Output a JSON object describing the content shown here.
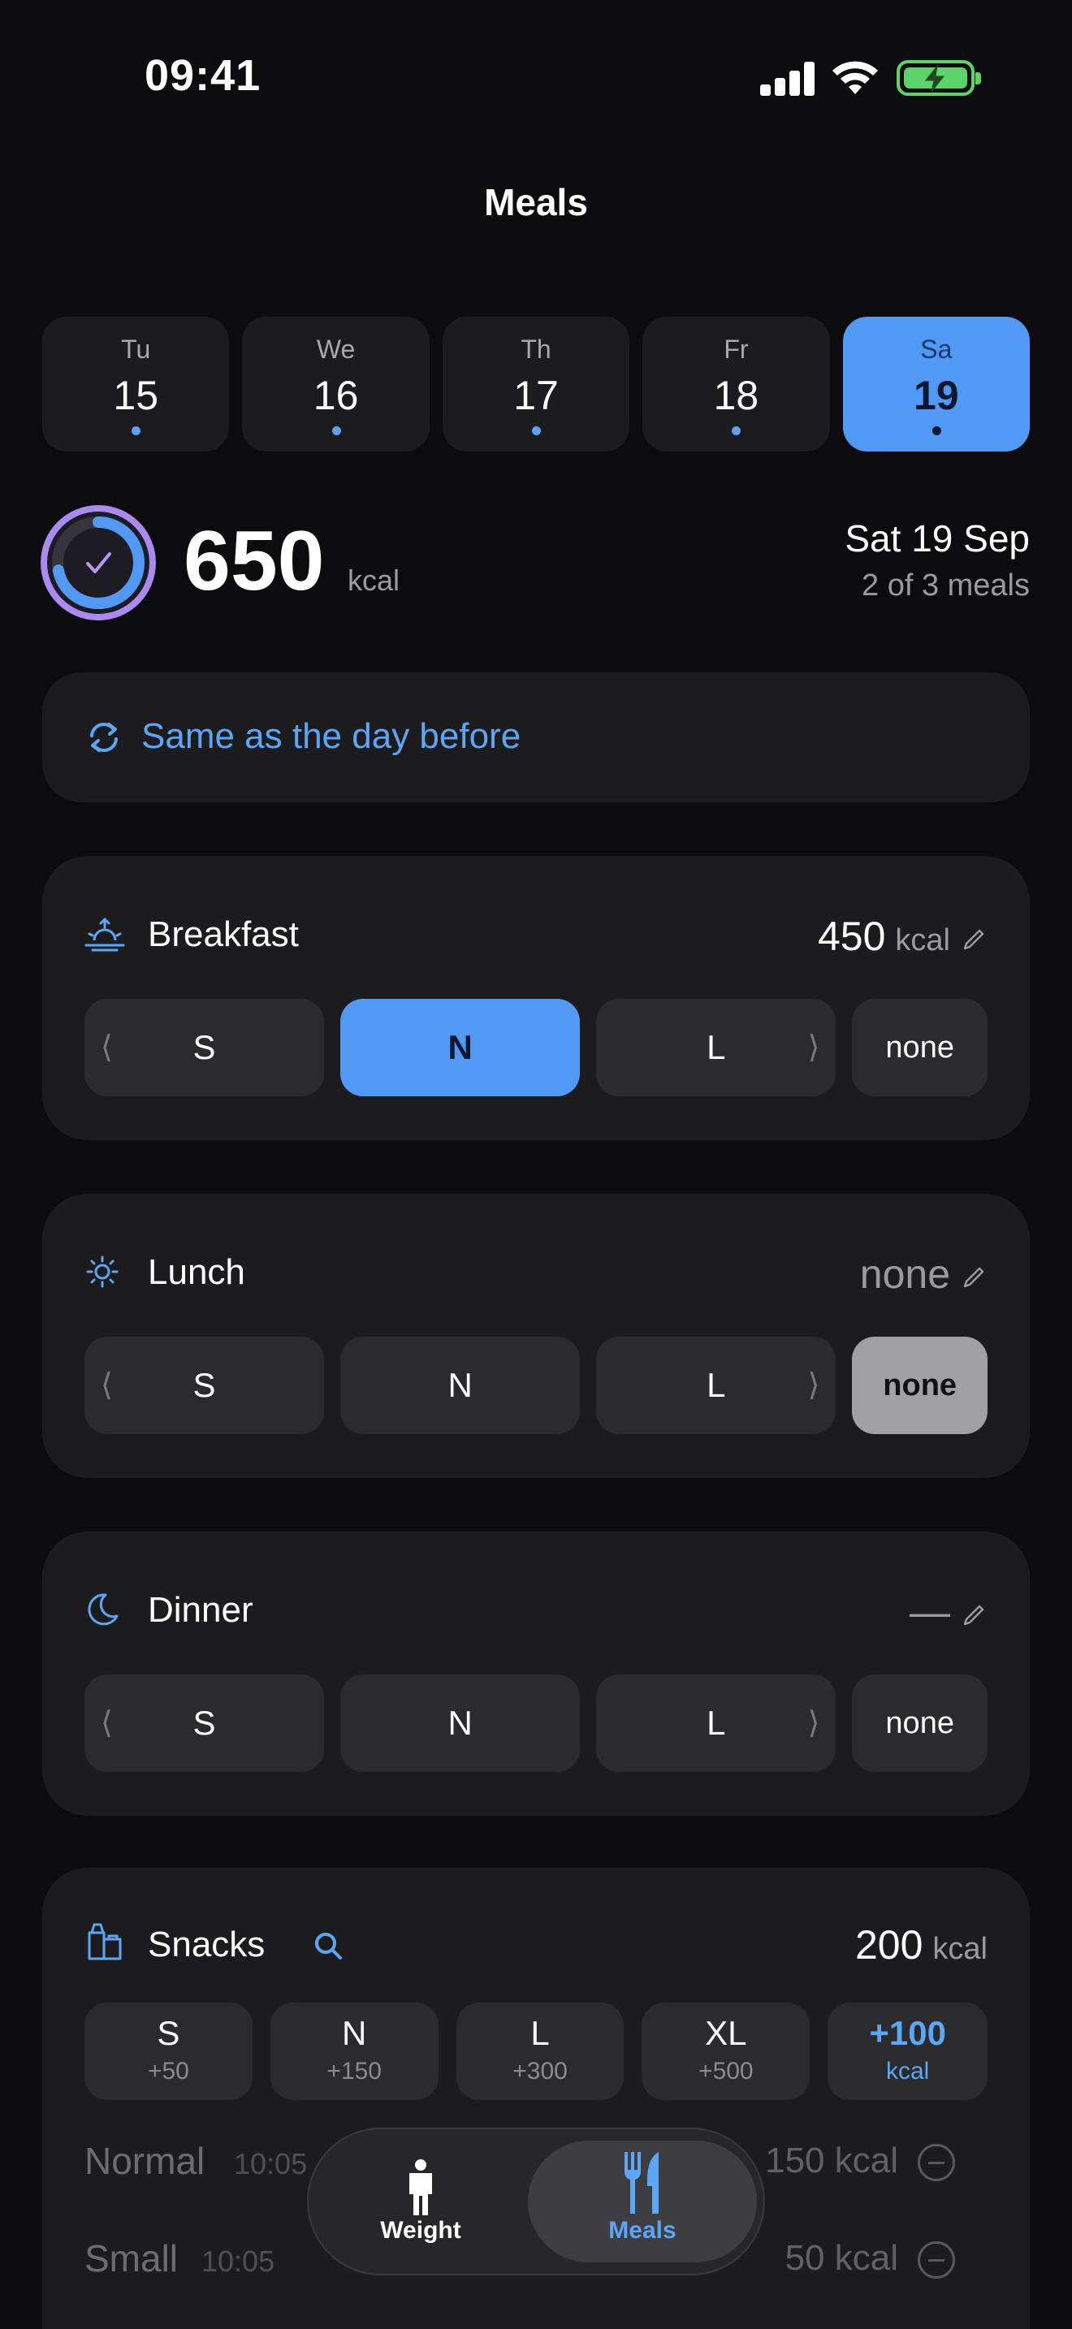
{
  "status_bar": {
    "time": "09:41"
  },
  "header": {
    "title": "Meals"
  },
  "days": [
    {
      "name": "Tu",
      "num": "15",
      "selected": false
    },
    {
      "name": "We",
      "num": "16",
      "selected": false
    },
    {
      "name": "Th",
      "num": "17",
      "selected": false
    },
    {
      "name": "Fr",
      "num": "18",
      "selected": false
    },
    {
      "name": "Sa",
      "num": "19",
      "selected": true
    }
  ],
  "summary": {
    "kcal": "650",
    "unit": "kcal",
    "date": "Sat 19 Sep",
    "meals_logged": "2 of 3 meals"
  },
  "same_as": {
    "label": "Same as the day before"
  },
  "meals": {
    "breakfast": {
      "name": "Breakfast",
      "value": "450",
      "unit": "kcal",
      "selected": "N"
    },
    "lunch": {
      "name": "Lunch",
      "value": "none",
      "selected": "none"
    },
    "dinner": {
      "name": "Dinner",
      "value": "—",
      "selected": ""
    }
  },
  "size_labels": {
    "s": "S",
    "n": "N",
    "l": "L",
    "none": "none",
    "chev_left": "⟨",
    "chev_right": "⟩"
  },
  "snacks": {
    "name": "Snacks",
    "value": "200",
    "unit": "kcal",
    "chips": [
      {
        "label": "S",
        "sub": "+50"
      },
      {
        "label": "N",
        "sub": "+150"
      },
      {
        "label": "L",
        "sub": "+300"
      },
      {
        "label": "XL",
        "sub": "+500"
      }
    ],
    "add": {
      "label": "+100",
      "sub": "kcal"
    },
    "entries": [
      {
        "name": "Normal",
        "time": "10:05",
        "kcal": "150 kcal"
      },
      {
        "name": "Small",
        "time": "10:05",
        "kcal": "50 kcal"
      }
    ]
  },
  "tabbar": {
    "weight": "Weight",
    "meals": "Meals"
  },
  "colors": {
    "accent": "#5199f5",
    "ring": "#a98af0",
    "card": "#1c1c1f",
    "background": "#0c0c0e"
  }
}
